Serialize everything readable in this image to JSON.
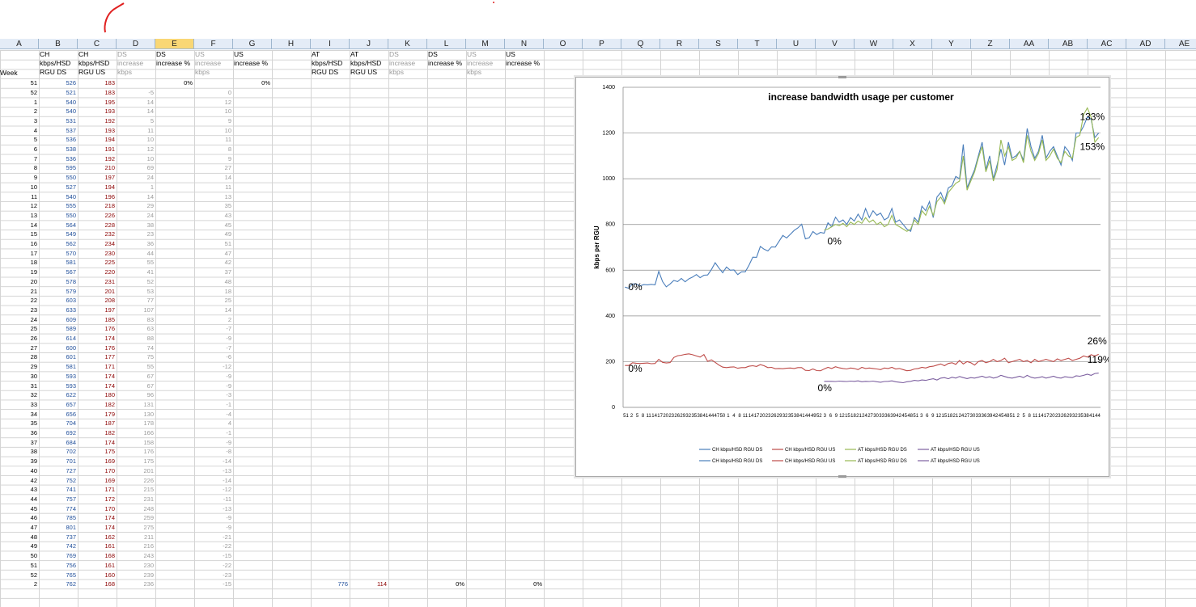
{
  "columns": [
    "A",
    "B",
    "C",
    "D",
    "E",
    "F",
    "G",
    "H",
    "I",
    "J",
    "K",
    "L",
    "M",
    "N",
    "O",
    "P",
    "Q",
    "R",
    "S",
    "T",
    "U",
    "V",
    "W",
    "X",
    "Y",
    "Z",
    "AA",
    "AB",
    "AC",
    "AD",
    "AE"
  ],
  "selected_column": "E",
  "headers": {
    "A": "Week",
    "B": "CH kbps/HSD RGU DS",
    "C": "CH kbps/HSD RGU US",
    "D": "DS increase kbps",
    "E": "DS increase %",
    "F": "US increase kbps",
    "G": "US increase %",
    "I": "AT kbps/HSD RGU DS",
    "J": "AT kbps/HSD RGU US",
    "K": "DS increase kbps",
    "L": "DS increase %",
    "M": "US increase kbps",
    "N": "US increase %"
  },
  "rows": [
    {
      "week": "51",
      "ds": "526",
      "us": "183",
      "dinc": "",
      "finc": "",
      "e": "0%",
      "g": "0%"
    },
    {
      "week": "52",
      "ds": "521",
      "us": "183",
      "dinc": "-5",
      "finc": "0"
    },
    {
      "week": "1",
      "ds": "540",
      "us": "195",
      "dinc": "14",
      "finc": "12"
    },
    {
      "week": "2",
      "ds": "540",
      "us": "193",
      "dinc": "14",
      "finc": "10"
    },
    {
      "week": "3",
      "ds": "531",
      "us": "192",
      "dinc": "5",
      "finc": "9"
    },
    {
      "week": "4",
      "ds": "537",
      "us": "193",
      "dinc": "11",
      "finc": "10"
    },
    {
      "week": "5",
      "ds": "536",
      "us": "194",
      "dinc": "10",
      "finc": "11"
    },
    {
      "week": "6",
      "ds": "538",
      "us": "191",
      "dinc": "12",
      "finc": "8"
    },
    {
      "week": "7",
      "ds": "536",
      "us": "192",
      "dinc": "10",
      "finc": "9"
    },
    {
      "week": "8",
      "ds": "595",
      "us": "210",
      "dinc": "69",
      "finc": "27"
    },
    {
      "week": "9",
      "ds": "550",
      "us": "197",
      "dinc": "24",
      "finc": "14"
    },
    {
      "week": "10",
      "ds": "527",
      "us": "194",
      "dinc": "1",
      "finc": "11"
    },
    {
      "week": "11",
      "ds": "540",
      "us": "196",
      "dinc": "14",
      "finc": "13"
    },
    {
      "week": "12",
      "ds": "555",
      "us": "218",
      "dinc": "29",
      "finc": "35"
    },
    {
      "week": "13",
      "ds": "550",
      "us": "226",
      "dinc": "24",
      "finc": "43"
    },
    {
      "week": "14",
      "ds": "564",
      "us": "228",
      "dinc": "38",
      "finc": "45"
    },
    {
      "week": "15",
      "ds": "549",
      "us": "232",
      "dinc": "23",
      "finc": "49"
    },
    {
      "week": "16",
      "ds": "562",
      "us": "234",
      "dinc": "36",
      "finc": "51"
    },
    {
      "week": "17",
      "ds": "570",
      "us": "230",
      "dinc": "44",
      "finc": "47"
    },
    {
      "week": "18",
      "ds": "581",
      "us": "225",
      "dinc": "55",
      "finc": "42"
    },
    {
      "week": "19",
      "ds": "567",
      "us": "220",
      "dinc": "41",
      "finc": "37"
    },
    {
      "week": "20",
      "ds": "578",
      "us": "231",
      "dinc": "52",
      "finc": "48"
    },
    {
      "week": "21",
      "ds": "579",
      "us": "201",
      "dinc": "53",
      "finc": "18"
    },
    {
      "week": "22",
      "ds": "603",
      "us": "208",
      "dinc": "77",
      "finc": "25"
    },
    {
      "week": "23",
      "ds": "633",
      "us": "197",
      "dinc": "107",
      "finc": "14"
    },
    {
      "week": "24",
      "ds": "609",
      "us": "185",
      "dinc": "83",
      "finc": "2"
    },
    {
      "week": "25",
      "ds": "589",
      "us": "176",
      "dinc": "63",
      "finc": "-7"
    },
    {
      "week": "26",
      "ds": "614",
      "us": "174",
      "dinc": "88",
      "finc": "-9"
    },
    {
      "week": "27",
      "ds": "600",
      "us": "176",
      "dinc": "74",
      "finc": "-7"
    },
    {
      "week": "28",
      "ds": "601",
      "us": "177",
      "dinc": "75",
      "finc": "-6"
    },
    {
      "week": "29",
      "ds": "581",
      "us": "171",
      "dinc": "55",
      "finc": "-12"
    },
    {
      "week": "30",
      "ds": "593",
      "us": "174",
      "dinc": "67",
      "finc": "-9"
    },
    {
      "week": "31",
      "ds": "593",
      "us": "174",
      "dinc": "67",
      "finc": "-9"
    },
    {
      "week": "32",
      "ds": "622",
      "us": "180",
      "dinc": "96",
      "finc": "-3"
    },
    {
      "week": "33",
      "ds": "657",
      "us": "182",
      "dinc": "131",
      "finc": "-1"
    },
    {
      "week": "34",
      "ds": "656",
      "us": "179",
      "dinc": "130",
      "finc": "-4"
    },
    {
      "week": "35",
      "ds": "704",
      "us": "187",
      "dinc": "178",
      "finc": "4"
    },
    {
      "week": "36",
      "ds": "692",
      "us": "182",
      "dinc": "166",
      "finc": "-1"
    },
    {
      "week": "37",
      "ds": "684",
      "us": "174",
      "dinc": "158",
      "finc": "-9"
    },
    {
      "week": "38",
      "ds": "702",
      "us": "175",
      "dinc": "176",
      "finc": "-8"
    },
    {
      "week": "39",
      "ds": "701",
      "us": "169",
      "dinc": "175",
      "finc": "-14"
    },
    {
      "week": "40",
      "ds": "727",
      "us": "170",
      "dinc": "201",
      "finc": "-13"
    },
    {
      "week": "42",
      "ds": "752",
      "us": "169",
      "dinc": "226",
      "finc": "-14"
    },
    {
      "week": "43",
      "ds": "741",
      "us": "171",
      "dinc": "215",
      "finc": "-12"
    },
    {
      "week": "44",
      "ds": "757",
      "us": "172",
      "dinc": "231",
      "finc": "-11"
    },
    {
      "week": "45",
      "ds": "774",
      "us": "170",
      "dinc": "248",
      "finc": "-13"
    },
    {
      "week": "46",
      "ds": "785",
      "us": "174",
      "dinc": "259",
      "finc": "-9"
    },
    {
      "week": "47",
      "ds": "801",
      "us": "174",
      "dinc": "275",
      "finc": "-9"
    },
    {
      "week": "48",
      "ds": "737",
      "us": "162",
      "dinc": "211",
      "finc": "-21"
    },
    {
      "week": "49",
      "ds": "742",
      "us": "161",
      "dinc": "216",
      "finc": "-22"
    },
    {
      "week": "50",
      "ds": "769",
      "us": "168",
      "dinc": "243",
      "finc": "-15"
    },
    {
      "week": "51",
      "ds": "756",
      "us": "161",
      "dinc": "230",
      "finc": "-22"
    },
    {
      "week": "52",
      "ds": "765",
      "us": "160",
      "dinc": "239",
      "finc": "-23"
    },
    {
      "week": "2",
      "ds": "762",
      "us": "168",
      "dinc": "236",
      "finc": "-15",
      "at_ds": "776",
      "at_us": "114",
      "l": "0%",
      "n": "0%"
    }
  ],
  "chart_data": {
    "type": "line",
    "title": "increase bandwidth usage per customer",
    "ylabel": "kbps per RGU",
    "xlabel": "",
    "ylim": [
      0,
      1400
    ],
    "yticks": [
      "0",
      "200",
      "400",
      "600",
      "800",
      "1000",
      "1200",
      "1400"
    ],
    "xticks": [
      "51",
      "2",
      "5",
      "8",
      "11",
      "14",
      "17",
      "20",
      "23",
      "26",
      "29",
      "32",
      "35",
      "38",
      "41",
      "44",
      "47",
      "50",
      "1",
      "4",
      "8",
      "11",
      "14",
      "17",
      "20",
      "23",
      "26",
      "29",
      "32",
      "35",
      "38",
      "41",
      "44",
      "49",
      "52",
      "3",
      "6",
      "9",
      "12",
      "15",
      "18",
      "21",
      "24",
      "27",
      "30",
      "33",
      "36",
      "39",
      "42",
      "45",
      "48",
      "51",
      "3",
      "6",
      "9",
      "12",
      "15",
      "18",
      "21",
      "24",
      "27",
      "30",
      "33",
      "36",
      "39",
      "42",
      "45",
      "48",
      "51",
      "2",
      "5",
      "8",
      "11",
      "14",
      "17",
      "20",
      "23",
      "26",
      "29",
      "32",
      "35",
      "38",
      "41",
      "44"
    ],
    "grid": true,
    "legend_position": "bottom",
    "legend": [
      "CH kbps/HSD RGU DS",
      "CH kbps/HSD RGU US",
      "AT kbps/HSD RGU DS",
      "AT kbps/HSD RGU US",
      "CH kbps/HSD RGU DS",
      "CH kbps/HSD RGU US",
      "AT kbps/HSD RGU DS",
      "AT kbps/HSD RGU US"
    ],
    "annotations": [
      "0%",
      "0%",
      "0%",
      "0%",
      "133%",
      "153%",
      "26%",
      "119%"
    ],
    "series": [
      {
        "name": "CH kbps/HSD RGU DS",
        "color": "#4a7ebb",
        "values": [
          526,
          521,
          540,
          540,
          531,
          537,
          536,
          538,
          536,
          595,
          550,
          527,
          540,
          555,
          550,
          564,
          549,
          562,
          570,
          581,
          567,
          578,
          579,
          603,
          633,
          609,
          589,
          614,
          600,
          601,
          581,
          593,
          593,
          622,
          657,
          656,
          704,
          692,
          684,
          702,
          701,
          727,
          752,
          741,
          757,
          774,
          785,
          801,
          737,
          742,
          769,
          756,
          765,
          762,
          807,
          790,
          832,
          810,
          820,
          800,
          830,
          815,
          845,
          820,
          870,
          830,
          860,
          840,
          850,
          820,
          830,
          870,
          810,
          820,
          800,
          780,
          770,
          830,
          810,
          880,
          860,
          900,
          830,
          920,
          940,
          900,
          960,
          970,
          1010,
          1000,
          1150,
          960,
          1000,
          1040,
          1100,
          1160,
          1040,
          1100,
          1000,
          1060,
          1130,
          1060,
          1160,
          1090,
          1100,
          1120,
          1080,
          1220,
          1140,
          1090,
          1120,
          1190,
          1090,
          1120,
          1140,
          1100,
          1060,
          1140,
          1120,
          1080,
          1200,
          1200,
          1230,
          1270,
          1260,
          1180,
          1200
        ]
      },
      {
        "name": "CH kbps/HSD RGU US",
        "color": "#be4b48",
        "values": [
          183,
          183,
          195,
          193,
          192,
          193,
          194,
          191,
          192,
          210,
          197,
          194,
          196,
          218,
          226,
          228,
          232,
          234,
          230,
          225,
          220,
          231,
          201,
          208,
          197,
          185,
          176,
          174,
          176,
          177,
          171,
          174,
          174,
          180,
          182,
          179,
          187,
          182,
          174,
          175,
          169,
          170,
          169,
          171,
          172,
          170,
          174,
          174,
          162,
          161,
          168,
          161,
          160,
          168,
          175,
          170,
          178,
          173,
          170,
          168,
          172,
          170,
          165,
          175,
          170,
          172,
          170,
          168,
          165,
          172,
          170,
          175,
          168,
          170,
          165,
          160,
          162,
          168,
          170,
          175,
          172,
          178,
          180,
          185,
          190,
          182,
          192,
          195,
          188,
          205,
          190,
          200,
          195,
          185,
          200,
          205,
          195,
          200,
          210,
          200,
          205,
          215,
          195,
          200,
          205,
          210,
          200,
          205,
          195,
          210,
          200,
          205,
          210,
          205,
          200,
          212,
          205,
          210,
          215,
          205,
          210,
          215,
          225,
          220,
          230,
          225,
          232
        ]
      },
      {
        "name": "AT kbps/HSD RGU DS",
        "color": "#98b954",
        "values": [
          null,
          null,
          null,
          null,
          null,
          null,
          null,
          null,
          null,
          null,
          null,
          null,
          null,
          null,
          null,
          null,
          null,
          null,
          null,
          null,
          null,
          null,
          null,
          null,
          null,
          null,
          null,
          null,
          null,
          null,
          null,
          null,
          null,
          null,
          null,
          null,
          null,
          null,
          null,
          null,
          null,
          null,
          null,
          null,
          null,
          null,
          null,
          null,
          null,
          null,
          null,
          null,
          null,
          776,
          780,
          790,
          800,
          795,
          805,
          790,
          810,
          800,
          815,
          805,
          830,
          810,
          820,
          800,
          810,
          790,
          800,
          840,
          800,
          790,
          780,
          770,
          780,
          820,
          800,
          860,
          840,
          880,
          840,
          900,
          920,
          890,
          940,
          960,
          980,
          990,
          1100,
          950,
          990,
          1030,
          1090,
          1140,
          1030,
          1080,
          990,
          1040,
          1170,
          1100,
          1140,
          1080,
          1090,
          1120,
          1070,
          1190,
          1120,
          1080,
          1110,
          1170,
          1080,
          1100,
          1130,
          1090,
          1070,
          1120,
          1100,
          1090,
          1180,
          1190,
          1280,
          1310,
          1270,
          1160,
          1180
        ]
      },
      {
        "name": "AT kbps/HSD RGU US",
        "color": "#7d60a0",
        "values": [
          null,
          null,
          null,
          null,
          null,
          null,
          null,
          null,
          null,
          null,
          null,
          null,
          null,
          null,
          null,
          null,
          null,
          null,
          null,
          null,
          null,
          null,
          null,
          null,
          null,
          null,
          null,
          null,
          null,
          null,
          null,
          null,
          null,
          null,
          null,
          null,
          null,
          null,
          null,
          null,
          null,
          null,
          null,
          null,
          null,
          null,
          null,
          null,
          null,
          null,
          null,
          null,
          null,
          114,
          114,
          114,
          113,
          115,
          114,
          113,
          115,
          114,
          116,
          112,
          114,
          113,
          115,
          112,
          110,
          113,
          114,
          116,
          112,
          110,
          108,
          112,
          114,
          118,
          116,
          120,
          118,
          122,
          125,
          120,
          128,
          130,
          125,
          132,
          128,
          135,
          130,
          126,
          130,
          128,
          132,
          136,
          130,
          134,
          128,
          132,
          140,
          135,
          130,
          128,
          132,
          136,
          130,
          140,
          132,
          128,
          130,
          134,
          128,
          132,
          136,
          130,
          128,
          134,
          132,
          130,
          138,
          136,
          140,
          145,
          140,
          148,
          150
        ]
      }
    ]
  }
}
